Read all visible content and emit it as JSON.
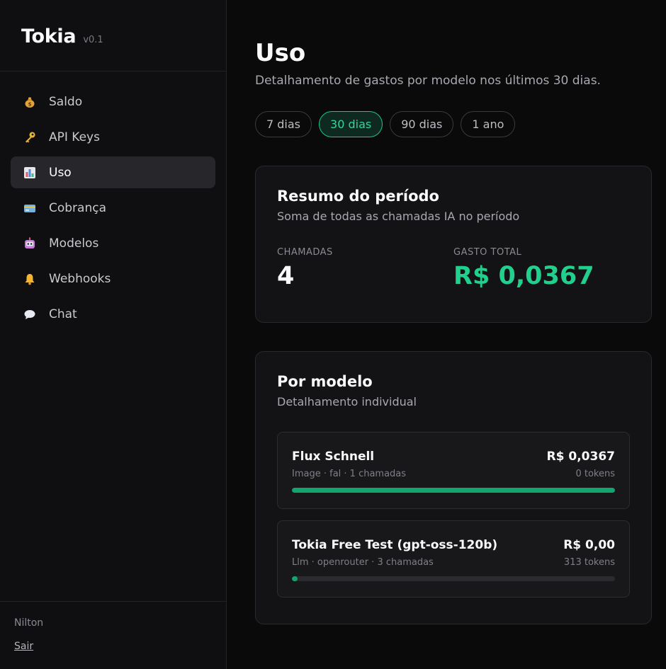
{
  "brand": {
    "name": "Tokia",
    "version": "v0.1"
  },
  "sidebar": {
    "items": [
      {
        "label": "Saldo",
        "icon": "money-bag-icon",
        "active": false
      },
      {
        "label": "API Keys",
        "icon": "key-icon",
        "active": false
      },
      {
        "label": "Uso",
        "icon": "bar-chart-icon",
        "active": true
      },
      {
        "label": "Cobrança",
        "icon": "credit-card-icon",
        "active": false
      },
      {
        "label": "Modelos",
        "icon": "robot-icon",
        "active": false
      },
      {
        "label": "Webhooks",
        "icon": "bell-icon",
        "active": false
      },
      {
        "label": "Chat",
        "icon": "speech-bubble-icon",
        "active": false
      }
    ],
    "user_name": "Nilton",
    "logout_label": "Sair"
  },
  "header": {
    "title": "Uso",
    "subtitle": "Detalhamento de gastos por modelo nos últimos 30 dias."
  },
  "ranges": [
    {
      "label": "7 dias",
      "active": false
    },
    {
      "label": "30 dias",
      "active": true
    },
    {
      "label": "90 dias",
      "active": false
    },
    {
      "label": "1 ano",
      "active": false
    }
  ],
  "summary": {
    "title": "Resumo do período",
    "subtitle": "Soma de todas as chamadas IA no período",
    "calls_label": "CHAMADAS",
    "calls_value": "4",
    "total_label": "GASTO TOTAL",
    "total_value": "R$ 0,0367"
  },
  "models": {
    "title": "Por modelo",
    "subtitle": "Detalhamento individual",
    "rows": [
      {
        "name": "Flux Schnell",
        "meta": "Image · fal · 1 chamadas",
        "cost": "R$ 0,0367",
        "tokens": "0 tokens",
        "share": 1.0
      },
      {
        "name": "Tokia Free Test (gpt-oss-120b)",
        "meta": "Llm · openrouter · 3 chamadas",
        "cost": "R$ 0,00",
        "tokens": "313 tokens",
        "share": 0.0
      }
    ]
  },
  "colors": {
    "accent": "#22d08e",
    "bar": "#12a56e",
    "background": "#0a0a0b"
  }
}
